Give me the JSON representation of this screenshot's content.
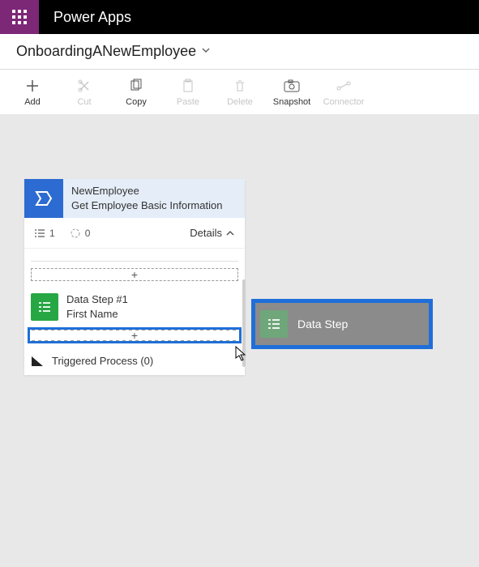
{
  "header": {
    "app_name": "Power Apps"
  },
  "breadcrumb": {
    "title": "OnboardingANewEmployee"
  },
  "toolbar": {
    "add": "Add",
    "cut": "Cut",
    "copy": "Copy",
    "paste": "Paste",
    "delete": "Delete",
    "snapshot": "Snapshot",
    "connector": "Connector"
  },
  "stage": {
    "name": "NewEmployee",
    "subtitle": "Get Employee Basic Information",
    "stats": {
      "steps": "1",
      "processes": "0"
    },
    "details_label": "Details",
    "step": {
      "title": "Data Step #1",
      "field": "First Name"
    },
    "add_slot_glyph": "+",
    "triggered_label": "Triggered Process (0)"
  },
  "drag_tile": {
    "label": "Data Step"
  }
}
